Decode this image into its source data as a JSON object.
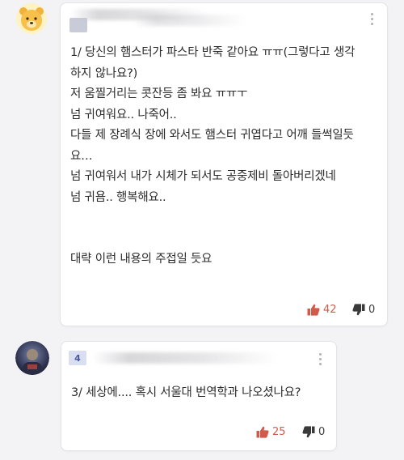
{
  "comments": [
    {
      "rank": "",
      "lines": [
        "1/ 당신의 햄스터가 파스타 반죽 같아요 ㅠㅠ(그렇다고 생각",
        "하지 않나요?)",
        "저 움찔거리는 콧잔등 좀 봐요 ㅠㅠㅜ",
        "넘 귀여워요.. 나죽어..",
        "다들 제 장례식 장에 와서도 햄스터 귀엽다고 어깨 들썩일듯",
        "요…",
        "넘 귀여워서 내가 시체가 되서도 공중제비 돌아버리겠네",
        "넘 귀욤.. 행복해요..",
        "",
        "대략 이런 내용의 주접일 듯요"
      ],
      "upvotes": "42",
      "downvotes": "0"
    },
    {
      "rank": "4",
      "lines": [
        "3/ 세상에.... 혹시 서울대 번역학과 나오셨나요?"
      ],
      "upvotes": "25",
      "downvotes": "0"
    }
  ],
  "colors": {
    "upvote": "#d25a4a",
    "downvote": "#3a3a3a",
    "card_bg": "#ffffff",
    "page_bg": "#f3f3f6"
  },
  "icons": {
    "upvote": "thumbs-up-icon",
    "downvote": "thumbs-down-icon",
    "more": "more-vertical-icon"
  }
}
